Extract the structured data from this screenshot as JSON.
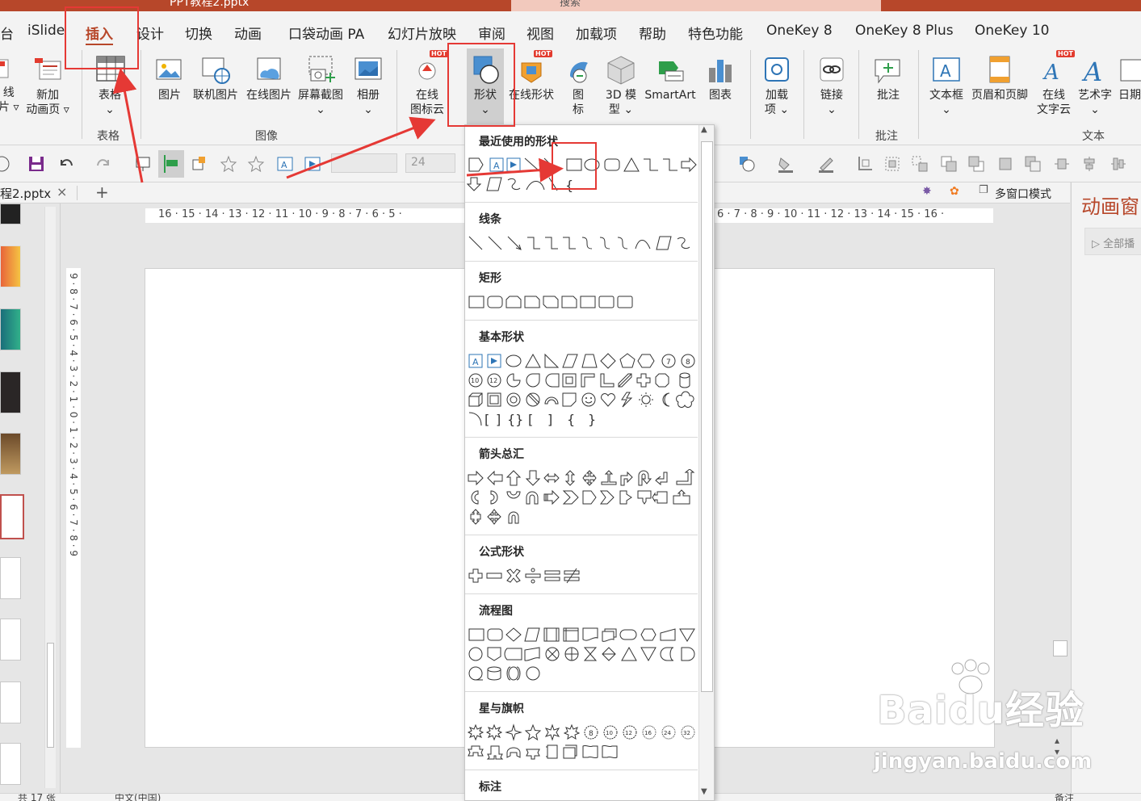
{
  "titlebar": {
    "doc": "PPT教程2.pptx",
    "search": "搜索"
  },
  "tabs": [
    "台",
    "iSlide",
    "插入",
    "设计",
    "切换",
    "动画",
    "口袋动画 PA",
    "幻灯片放映",
    "审阅",
    "视图",
    "加载项",
    "帮助",
    "特色功能",
    "OneKey 8",
    "OneKey 8 Plus",
    "OneKey 10"
  ],
  "active_tab": "插入",
  "ribbon": {
    "left_cut": {
      "line1": "线",
      "line2": "片 ▿"
    },
    "new_anim": {
      "line1": "新加",
      "line2": "动画页 ▿"
    },
    "table": {
      "label": "表格",
      "arrow": "⌄"
    },
    "table_group": "表格",
    "images": [
      "图片",
      "联机图片",
      "在线图片",
      "屏幕截图",
      "相册"
    ],
    "images_group": "图像",
    "online_icons": {
      "line1": "在线",
      "line2": "图标云"
    },
    "shapes": {
      "label": "形状",
      "arrow": "⌄"
    },
    "online_shapes": "在线形状",
    "icons": {
      "line1": "图",
      "line2": "标"
    },
    "model3d": {
      "line1": "3D 模",
      "line2": "型 ⌄"
    },
    "smartart": "SmartArt",
    "chart": "图表",
    "addin": {
      "line1": "加载",
      "line2": "项 ⌄"
    },
    "link": {
      "label": "链接",
      "arrow": "⌄"
    },
    "comment": "批注",
    "comment_group": "批注",
    "textbox": {
      "label": "文本框",
      "arrow": "⌄"
    },
    "header_footer": "页眉和页脚",
    "online_wordcloud": {
      "line1": "在线",
      "line2": "文字云"
    },
    "wordart": {
      "label": "艺术字",
      "arrow": "⌄"
    },
    "date": "日期",
    "text_group": "文本",
    "hot": "HOT"
  },
  "qat": {
    "font_name": "",
    "font_size": "24"
  },
  "doc_tab": {
    "name": "程2.pptx",
    "close": "×",
    "add": "+"
  },
  "multiwindow": "多窗口模式",
  "anim_pane": {
    "title": "动画窗",
    "item": "全部播"
  },
  "hruler": "16 · 15 · 14 · 13 · 12 · 11 · 10 · 9 · 8 · 7 · 6 · 5 ·",
  "hruler_right": "6 · 7 · 8 · 9 · 10 · 11 · 12 · 13 · 14 · 15 · 16 ·",
  "vruler": "9 · 8 · 7 · 6 · 5 · 4 · 3 · 2 · 1 · 0 · 1 · 2 · 3 · 4 · 5 · 6 · 7 · 8 · 9",
  "status": {
    "slides": "共 17 张",
    "lang": "中文(中国)",
    "notes": "备注"
  },
  "menu": {
    "sections": [
      "最近使用的形状",
      "线条",
      "矩形",
      "基本形状",
      "箭头总汇",
      "公式形状",
      "流程图",
      "星与旗帜",
      "标注"
    ],
    "recent": "▷ A ▷ ╲ ╲ ↘ ▭ ⬭ ▢ △ ⅂ ⅂ ⇨",
    "recent2": "⇩ ▱ ☡ ◠ ╲ {",
    "lines": "╲ ╲ ↘ ⅂ ⅂ ⅂ ⸙ ⸙ ⸙ ⌒ ▱ ☡",
    "rects": "▭ ▢ ⌂ ⬠ ▭ ▭ ▭ ▭ ▭",
    "basic1": "A ▷ ⬭ △ ◺ ▱ ⏢ ◇ ⬠ ⬡ ⑦ ⑧",
    "basic2": "⑩ ⑫ ◔ ◑ ◗ ▣ ⌐ ◣ ⁄ ✚ ✚ ⌸",
    "basic3": "◫ ▣ ◎ ⊘ ⌒ ▯ ☺ ♡ ⚡ ☼ ☾ ☁",
    "basic4": "⌒ [ ] { } [ ] { }",
    "arrows1": "⇨ ⇦ ⇧ ⇩ ⇔ ⇕ ✣ ⊥ ↱ ↶ ↲ ⅃",
    "arrows2": "↺ ↻ ↷ ∩ ⇛ ⇛ ▷ ▷ ▷ ⍗ ⍇ ⍐",
    "arrows3": "⇳ ✣ ∩",
    "math": "✚ ━ ✖ ÷ ═ ≠",
    "flow1": "▭ ▢ ◇ ▱ ◫ ◫ ◫ ◫ ⬭ ⬡ ◺ ▽",
    "flow2": "○ ⬠ ▭ ▱ ⊗ ⊕ ⧗ ◇ △ ▽ ◗ ◗",
    "flow3": "⌓ ⊖ ◎ ○",
    "stars1": "✹ ✷ ✦ ☆ ✩ ✰ ⑧ ⑩ ⑫ ⑯ ㉔ ㉜",
    "stars2": "⛿ ⛿ ⛿ ⛿ ▯ ▯ ⌇ ⌇"
  },
  "watermark": {
    "brand": "Baidu经验",
    "url": "jingyan.baidu.com"
  }
}
